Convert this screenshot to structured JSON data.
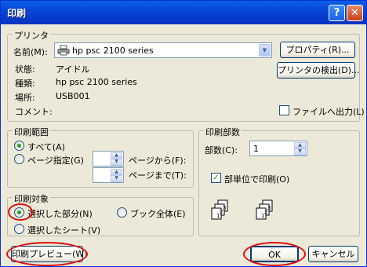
{
  "window": {
    "title": "印刷",
    "help_glyph": "?",
    "close_glyph": "✕"
  },
  "printer": {
    "legend": "プリンタ",
    "name_label": "名前(M):",
    "name_value": "hp psc 2100 series",
    "properties_button": "プロパティ(R)...",
    "find_printer_button": "プリンタの検出(D)...",
    "status_label": "状態:",
    "status_value": "アイドル",
    "type_label": "種類:",
    "type_value": "hp psc 2100 series",
    "location_label": "場所:",
    "location_value": "USB001",
    "comment_label": "コメント:",
    "print_to_file_label": "ファイルへ出力(L)"
  },
  "range": {
    "legend": "印刷範囲",
    "all_label": "すべて(A)",
    "pages_label": "ページ指定(G)",
    "from_label": "ページから(F):",
    "to_label": "ページまで(T):",
    "from_value": "",
    "to_value": ""
  },
  "copies": {
    "legend": "印刷部数",
    "count_label": "部数(C):",
    "count_value": "1",
    "collate_label": "部単位で印刷(O)"
  },
  "target": {
    "legend": "印刷対象",
    "selection_label": "選択した部分(N)",
    "workbook_label": "ブック全体(E)",
    "sheets_label": "選択したシート(V)"
  },
  "footer": {
    "preview_button": "印刷プレビュー(W)",
    "ok_button": "OK",
    "cancel_button": "キャンセル"
  },
  "colors": {
    "highlight": "#e01010",
    "titlebar": "#0846d6",
    "check_mark": "#21a121"
  },
  "icons": {
    "printer": "printer-icon",
    "collate_1": "collated-pages-icon",
    "collate_2": "collated-pages-icon"
  }
}
